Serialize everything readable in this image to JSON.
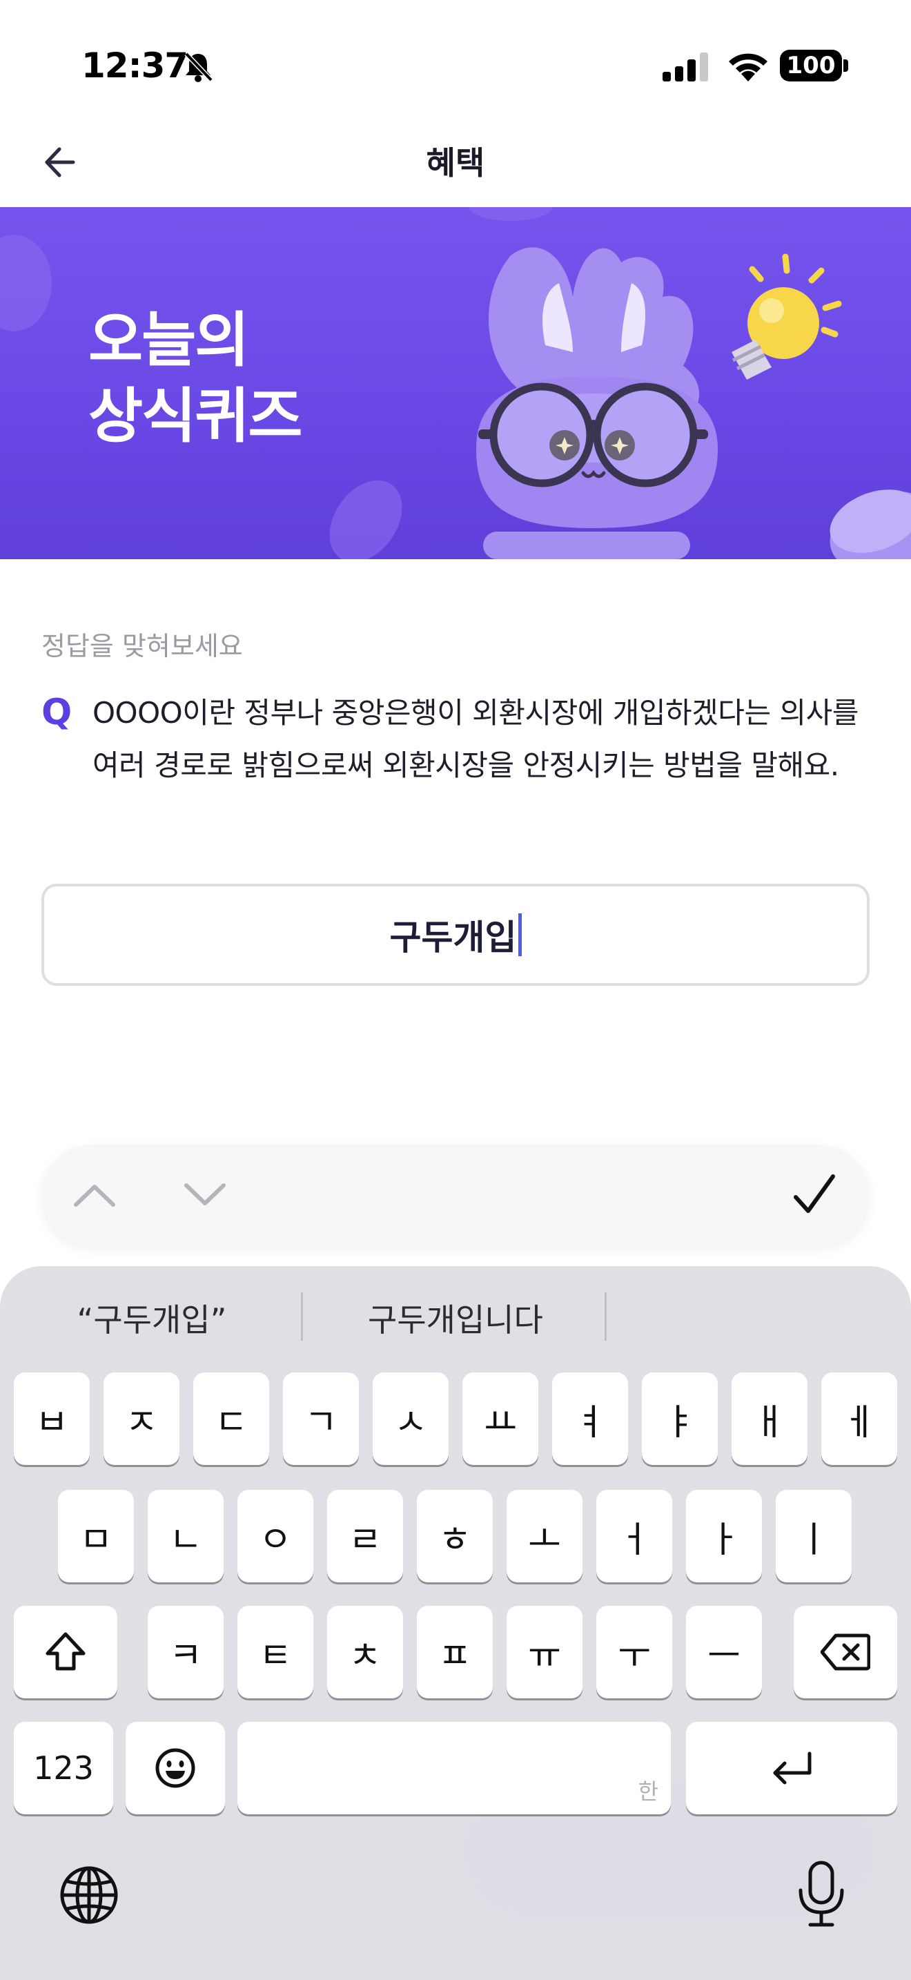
{
  "status_bar": {
    "time": "12:37",
    "battery": "100"
  },
  "nav": {
    "title": "혜택"
  },
  "banner": {
    "title_line1": "오늘의",
    "title_line2": "상식퀴즈"
  },
  "quiz": {
    "hint": "정답을 맞혀보세요",
    "q_mark": "Q",
    "question": "OOOO이란 정부나 중앙은행이 외환시장에 개입하겠다는 의사를 여러 경로로 밝힘으로써 외환시장을 안정시키는 방법을 말해요.",
    "answer_value": "구두개입"
  },
  "keyboard": {
    "suggestions": [
      "“구두개입”",
      "구두개입니다"
    ],
    "row1": [
      "ㅂ",
      "ㅈ",
      "ㄷ",
      "ㄱ",
      "ㅅ",
      "ㅛ",
      "ㅕ",
      "ㅑ",
      "ㅐ",
      "ㅔ"
    ],
    "row2": [
      "ㅁ",
      "ㄴ",
      "ㅇ",
      "ㄹ",
      "ㅎ",
      "ㅗ",
      "ㅓ",
      "ㅏ",
      "ㅣ"
    ],
    "row3": [
      "ㅋ",
      "ㅌ",
      "ㅊ",
      "ㅍ",
      "ㅠ",
      "ㅜ",
      "ㅡ"
    ],
    "numbers_key": "123",
    "space_hint": "한"
  },
  "colors": {
    "accent": "#5b3fe0",
    "banner": "#6a49e6",
    "caret": "#4c5cf0"
  },
  "icons": [
    "back-arrow-icon",
    "bell-slash-icon",
    "signal-icon",
    "wifi-icon",
    "chevron-up-icon",
    "chevron-down-icon",
    "checkmark-icon",
    "shift-icon",
    "delete-icon",
    "emoji-icon",
    "return-icon",
    "globe-icon",
    "microphone-icon"
  ]
}
